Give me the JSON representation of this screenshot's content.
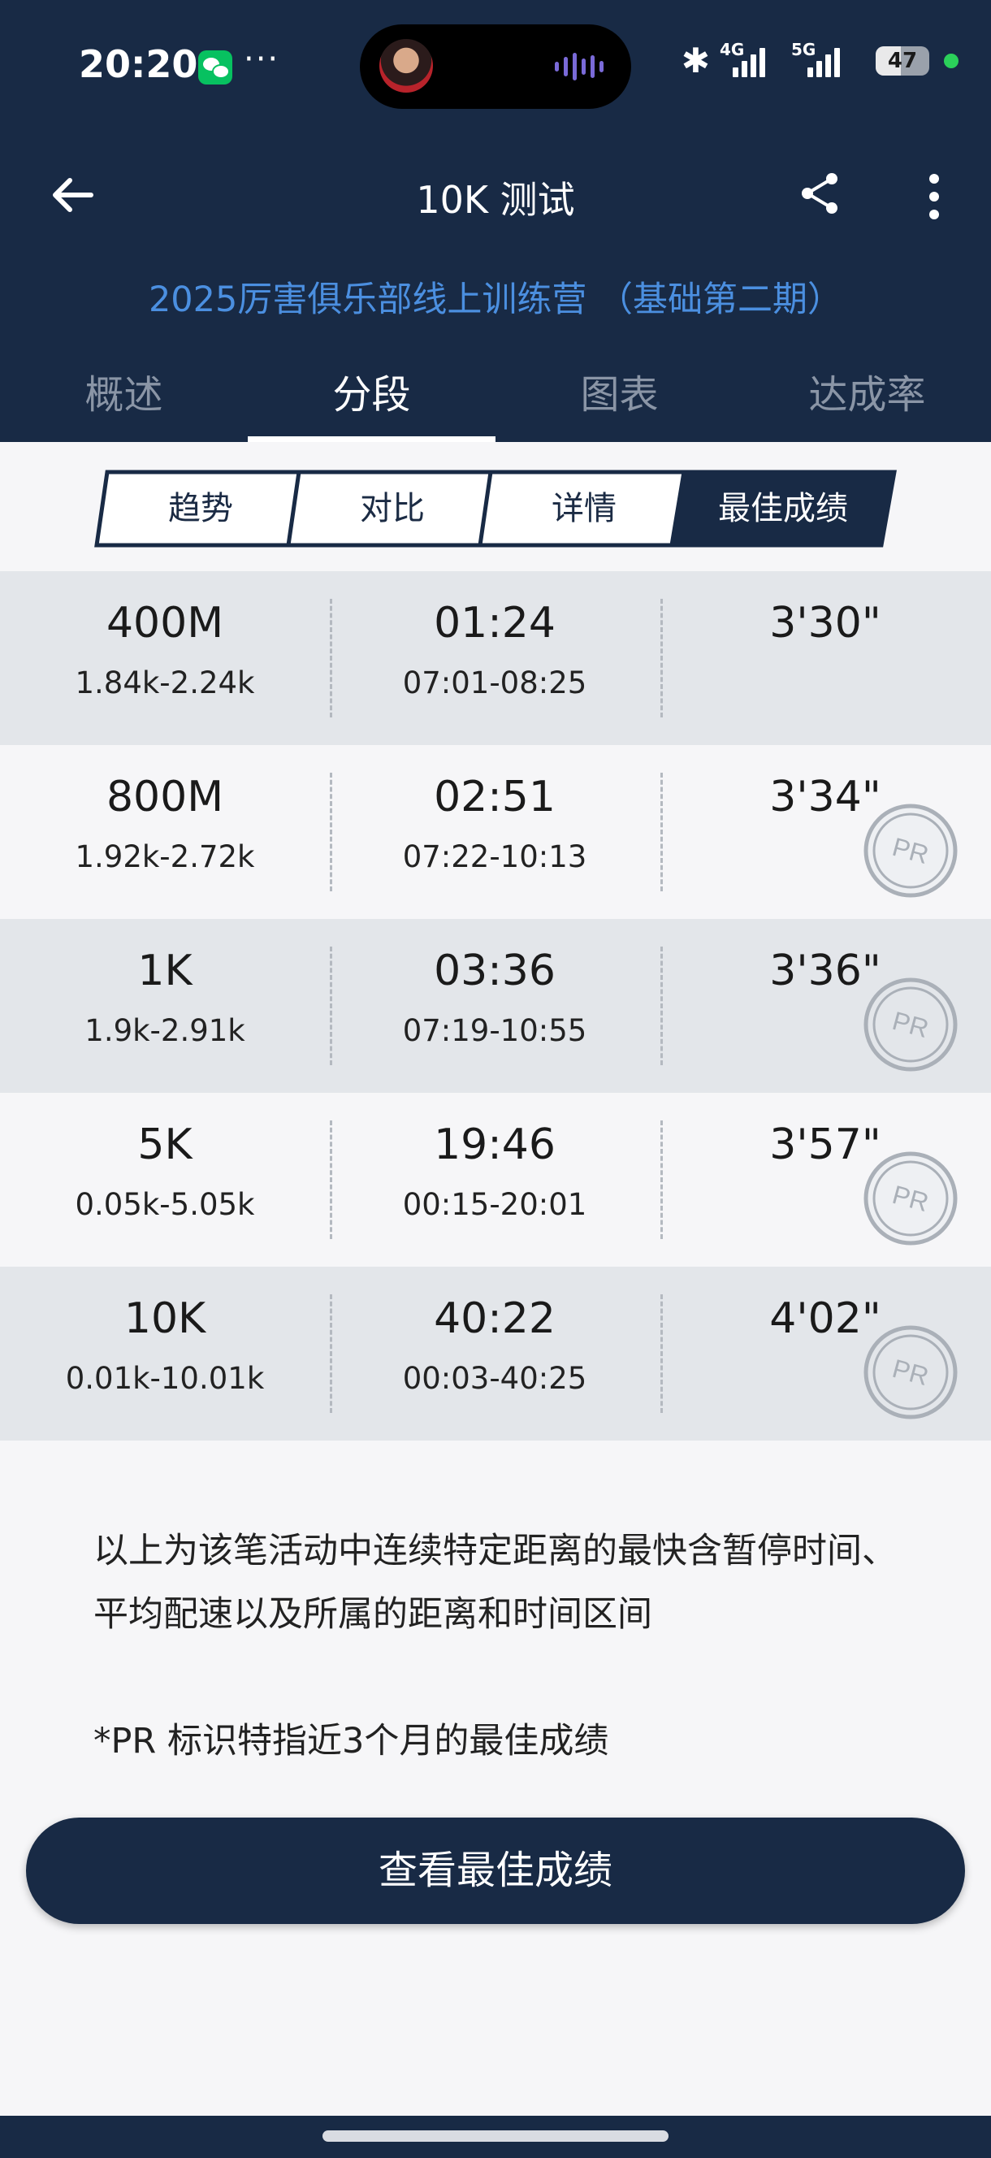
{
  "status_bar": {
    "time": "20:20",
    "more": "···",
    "net1": "4G",
    "net2": "5G",
    "battery": "47",
    "battery_level": 0.47
  },
  "header": {
    "title": "10K 测试",
    "subtitle": "2025厉害俱乐部线上训练营 （基础第二期）"
  },
  "tabs": [
    "概述",
    "分段",
    "图表",
    "达成率"
  ],
  "active_tab": "分段",
  "segments": [
    "趋势",
    "对比",
    "详情",
    "最佳成绩"
  ],
  "active_segment": "最佳成绩",
  "rows": [
    {
      "distance": "400M",
      "distance_range": "1.84k-2.24k",
      "time": "01:24",
      "time_range": "07:01-08:25",
      "pace": "3'30\"",
      "pr": false
    },
    {
      "distance": "800M",
      "distance_range": "1.92k-2.72k",
      "time": "02:51",
      "time_range": "07:22-10:13",
      "pace": "3'34\"",
      "pr": true
    },
    {
      "distance": "1K",
      "distance_range": "1.9k-2.91k",
      "time": "03:36",
      "time_range": "07:19-10:55",
      "pace": "3'36\"",
      "pr": true
    },
    {
      "distance": "5K",
      "distance_range": "0.05k-5.05k",
      "time": "19:46",
      "time_range": "00:15-20:01",
      "pace": "3'57\"",
      "pr": true
    },
    {
      "distance": "10K",
      "distance_range": "0.01k-10.01k",
      "time": "40:22",
      "time_range": "00:03-40:25",
      "pace": "4'02\"",
      "pr": true
    }
  ],
  "pr_label": "PR",
  "notes": {
    "line1": "以上为该笔活动中连续特定距离的最快含暂停时间、平均配速以及所属的距离和时间区间",
    "line2": "*PR 标识特指近3个月的最佳成绩"
  },
  "cta_label": "查看最佳成绩"
}
